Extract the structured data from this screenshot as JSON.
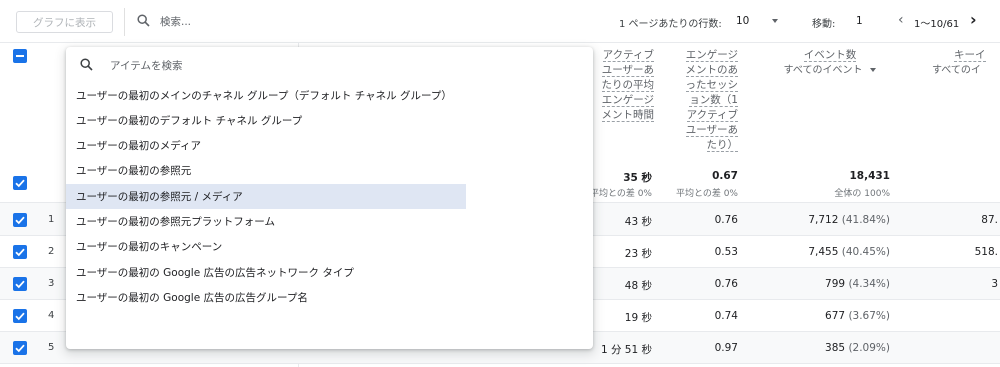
{
  "toolbar": {
    "graph_button": "グラフに表示",
    "search_placeholder": "検索...",
    "rows_per_page_label": "1 ページあたりの行数:",
    "rows_per_page_value": "10",
    "move_label": "移動:",
    "move_value": "1",
    "range_text": "1〜10/61",
    "prev_icon": "chevron-left-icon",
    "next_icon": "chevron-right-icon"
  },
  "table": {
    "headers": {
      "avg_engagement": [
        "アクティブ",
        "ユーザーあ",
        "たりの平均",
        "エンゲージ",
        "メント時間"
      ],
      "sessions_per_user": [
        "エンゲージ",
        "メントのあ",
        "ったセッシ",
        "ョン数（1",
        "アクティブ",
        "ユーザーあ",
        "たり）"
      ],
      "event_count_title": "イベント数",
      "event_count_sub": "すべてのイベント",
      "key_event_title": "キーイ",
      "key_event_sub": "すべてのイ"
    },
    "totals": {
      "avg_engagement": "35 秒",
      "avg_engagement_sub": "平均との差 0%",
      "sessions_per_user": "0.67",
      "sessions_per_user_sub": "平均との差 0%",
      "event_count": "18,431",
      "event_count_sub": "全体の 100%"
    },
    "rows": [
      {
        "num": "1",
        "avg_engagement": "43 秒",
        "sessions_per_user": "0.76",
        "event_count": "7,712",
        "event_pct": "(41.84%)",
        "key_event": "87."
      },
      {
        "num": "2",
        "avg_engagement": "23 秒",
        "sessions_per_user": "0.53",
        "event_count": "7,455",
        "event_pct": "(40.45%)",
        "key_event": "518."
      },
      {
        "num": "3",
        "avg_engagement": "48 秒",
        "sessions_per_user": "0.76",
        "event_count": "799",
        "event_pct": "(4.34%)",
        "key_event": "3"
      },
      {
        "num": "4",
        "avg_engagement": "19 秒",
        "sessions_per_user": "0.74",
        "event_count": "677",
        "event_pct": "(3.67%)",
        "key_event": ""
      },
      {
        "num": "5",
        "avg_engagement": "1 分 51 秒",
        "sessions_per_user": "0.97",
        "event_count": "385",
        "event_pct": "(2.09%)",
        "key_event": ""
      }
    ]
  },
  "dropdown": {
    "search_placeholder": "アイテムを検索",
    "items": [
      "ユーザーの最初のメインのチャネル グループ（デフォルト チャネル グループ）",
      "ユーザーの最初のデフォルト チャネル グループ",
      "ユーザーの最初のメディア",
      "ユーザーの最初の参照元",
      "ユーザーの最初の参照元 / メディア",
      "ユーザーの最初の参照元プラットフォーム",
      "ユーザーの最初のキャンペーン",
      "ユーザーの最初の Google 広告の広告ネットワーク タイプ",
      "ユーザーの最初の Google 広告の広告グループ名"
    ],
    "active_index": 4
  },
  "colors": {
    "accent": "#1a73e8",
    "highlight": "#dfe6f3",
    "row_alt": "#f8f9fa"
  }
}
